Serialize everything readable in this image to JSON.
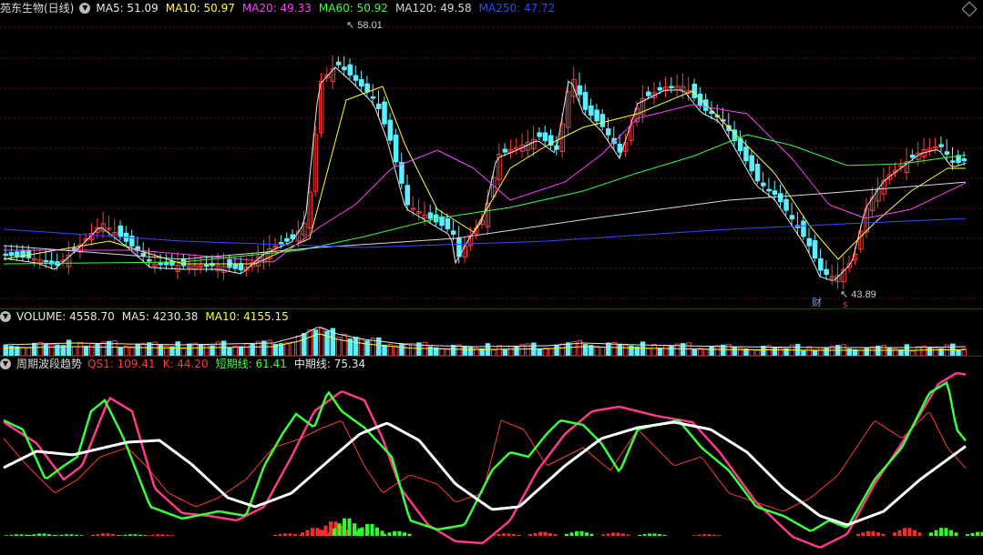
{
  "main_panel": {
    "title": "苑东生物(日线)",
    "indicators": [
      {
        "label": "MA5: 51.09",
        "color": "#e8e8e8"
      },
      {
        "label": "MA10: 50.97",
        "color": "#ffff3c"
      },
      {
        "label": "MA20: 49.33",
        "color": "#ff40ff"
      },
      {
        "label": "MA60: 50.92",
        "color": "#3cff3c"
      },
      {
        "label": "MA120: 49.58",
        "color": "#d8d8d8"
      },
      {
        "label": "MA250: 47.72",
        "color": "#2b4cff"
      }
    ],
    "high_label": "58.01",
    "low_label": "43.89",
    "cai_label": "财",
    "s_label": "s"
  },
  "volume_panel": {
    "indicators": [
      {
        "label": "VOLUME: 4558.70",
        "color": "#e8e8e8"
      },
      {
        "label": "MA5: 4230.38",
        "color": "#e8e8e8"
      },
      {
        "label": "MA10: 4155.15",
        "color": "#ffff3c"
      }
    ]
  },
  "wave_panel": {
    "title": "周期波段趋势",
    "indicators": [
      {
        "label": "QS1: 109.41",
        "color": "#ff3a3a"
      },
      {
        "label": "K: 44.20",
        "color": "#ff3a3a"
      },
      {
        "label": "短期线: 61.41",
        "color": "#3cff3c"
      },
      {
        "label": "中期线: 75.34",
        "color": "#e8e8e8"
      }
    ]
  },
  "colors": {
    "up": "#ff3a3a",
    "down": "#5cf0ff",
    "grid": "#7a0c0c"
  }
}
